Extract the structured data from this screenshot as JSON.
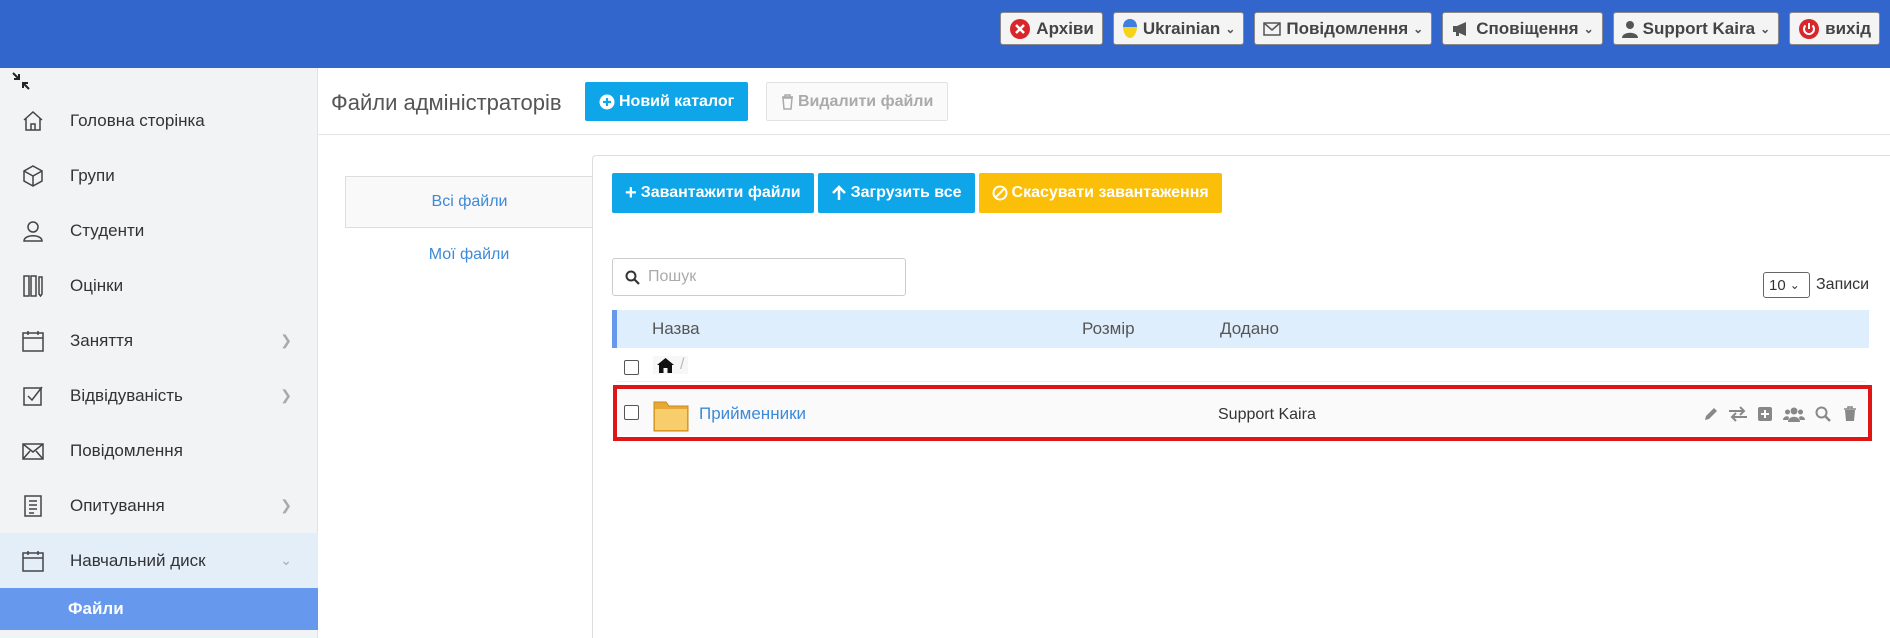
{
  "topbar": {
    "archives": "Архіви",
    "language": "Ukrainian",
    "messages": "Повідомлення",
    "notifications": "Сповіщення",
    "user": "Support Kaira",
    "logout": "вихід",
    "accent": "#3366cc"
  },
  "sidebar": {
    "items": [
      {
        "label": "Головна сторінка",
        "icon": "home-icon"
      },
      {
        "label": "Групи",
        "icon": "cube-icon"
      },
      {
        "label": "Студенти",
        "icon": "user-icon"
      },
      {
        "label": "Оцінки",
        "icon": "grades-icon"
      },
      {
        "label": "Заняття",
        "icon": "calendar-icon"
      },
      {
        "label": "Відвідуваність",
        "icon": "checkbox-icon"
      },
      {
        "label": "Повідомлення",
        "icon": "envelope-icon"
      },
      {
        "label": "Опитування",
        "icon": "survey-icon"
      },
      {
        "label": "Навчальний диск",
        "icon": "calendar-icon"
      }
    ],
    "subitem": "Файли"
  },
  "header": {
    "title": "Файли адміністраторів",
    "new_folder": "Новий каталог",
    "delete_files": "Видалити файли"
  },
  "file_tabs": {
    "all": "Всі файли",
    "mine": "Мої файли"
  },
  "toolbar": {
    "upload": "Завантажити файли",
    "upload_all": "Загрузить все",
    "cancel_upload": "Скасувати завантаження"
  },
  "search": {
    "placeholder": "Пошук"
  },
  "pagination": {
    "per_page": "10",
    "records_label": "Записи"
  },
  "table": {
    "columns": [
      "Назва",
      "Розмір",
      "Додано"
    ],
    "breadcrumb_sep": "/",
    "rows": [
      {
        "name": "Прийменники",
        "size": "",
        "added": "Support Kaira"
      }
    ]
  }
}
